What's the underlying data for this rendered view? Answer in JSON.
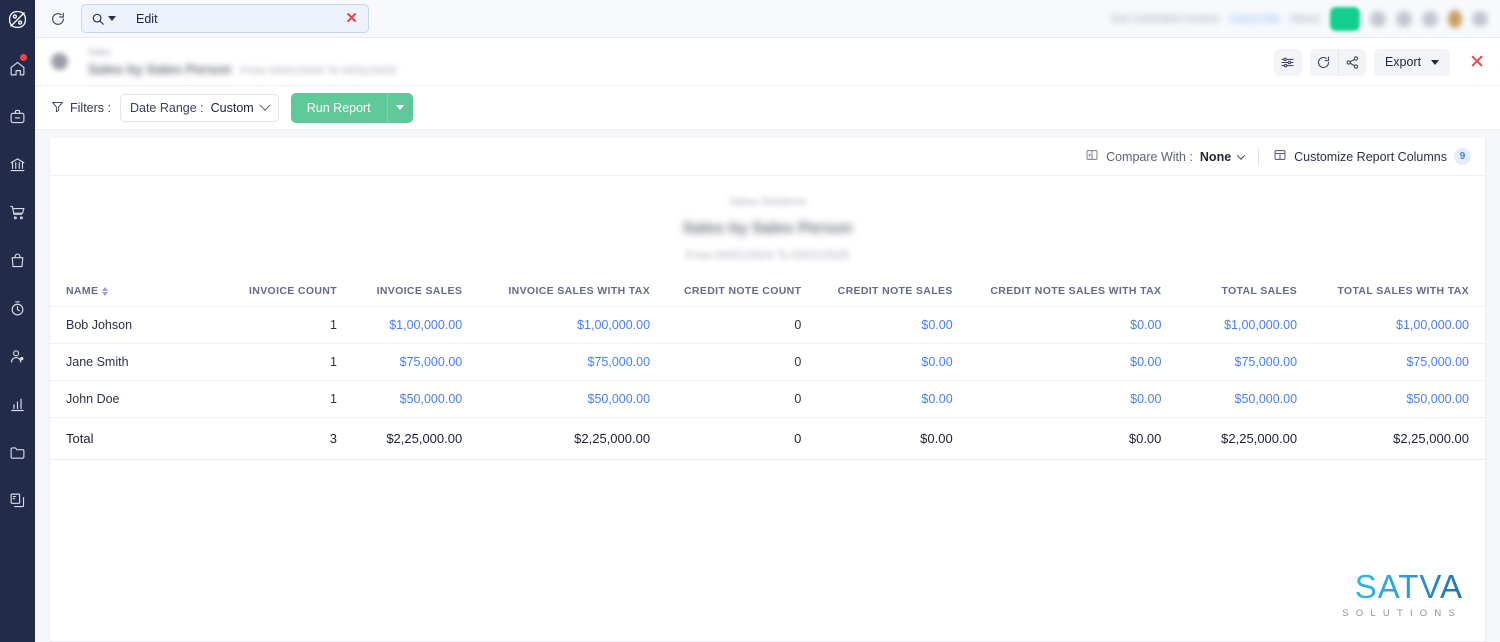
{
  "sidebar": {
    "logo_icon": "brand-b-logo-icon",
    "items": [
      {
        "icon": "home-icon",
        "name": "home",
        "badge": true
      },
      {
        "icon": "briefcase-icon",
        "name": "briefcase",
        "badge": false
      },
      {
        "icon": "bank-icon",
        "name": "banking",
        "badge": false
      },
      {
        "icon": "shopping-cart-icon",
        "name": "sales",
        "badge": false
      },
      {
        "icon": "shopping-bag-icon",
        "name": "purchases",
        "badge": false
      },
      {
        "icon": "stopwatch-icon",
        "name": "time-tracking",
        "badge": false
      },
      {
        "icon": "user-icon",
        "name": "contacts",
        "badge": false
      },
      {
        "icon": "bar-chart-icon",
        "name": "reports",
        "badge": false
      },
      {
        "icon": "folder-icon",
        "name": "documents",
        "badge": false
      },
      {
        "icon": "copy-document-icon",
        "name": "templates",
        "badge": false
      }
    ]
  },
  "topbar": {
    "refresh_icon": "refresh-icon",
    "search": {
      "icon": "search-icon",
      "value": "Edit",
      "clear_icon": "clear-x-icon"
    },
    "right_blurred": {
      "label_1": "Get Unlimited Invoice",
      "label_2": "Subscribe",
      "label_3": "About",
      "chip": "add-new-button",
      "icons": [
        "search-icon",
        "help-icon",
        "bell-icon",
        "avatar-icon",
        "apps-icon"
      ]
    }
  },
  "page_header": {
    "eyebrow": "Sales",
    "title": "Sales by Sales Person",
    "subtitle": "From 04/01/2024 To 03/31/2025",
    "actions": {
      "settings_icon": "sliders-icon",
      "refresh_icon": "refresh-icon",
      "share_icon": "share-icon",
      "export_label": "Export",
      "close_icon": "close-x-icon"
    }
  },
  "filters": {
    "funnel_icon": "funnel-icon",
    "label": "Filters :",
    "date_range_label": "Date Range :",
    "date_range_value": "Custom",
    "run_report_label": "Run Report"
  },
  "report_toolbar": {
    "compare_icon": "compare-panels-icon",
    "compare_label": "Compare With :",
    "compare_value": "None",
    "customize_icon": "columns-layout-icon",
    "customize_label": "Customize Report Columns",
    "customize_badge": "9"
  },
  "report_title": {
    "organization": "Satva Solutions",
    "name": "Sales by Sales Person",
    "range": "From 04/01/2024 To 03/31/2025"
  },
  "table": {
    "columns": [
      "NAME",
      "INVOICE COUNT",
      "INVOICE SALES",
      "INVOICE SALES WITH TAX",
      "CREDIT NOTE COUNT",
      "CREDIT NOTE SALES",
      "CREDIT NOTE SALES WITH TAX",
      "TOTAL SALES",
      "TOTAL SALES WITH TAX"
    ],
    "sort_column": "NAME",
    "rows": [
      {
        "name": "Bob Johson",
        "invoice_count": "1",
        "invoice_sales": "$1,00,000.00",
        "invoice_sales_with_tax": "$1,00,000.00",
        "credit_note_count": "0",
        "credit_note_sales": "$0.00",
        "credit_note_sales_with_tax": "$0.00",
        "total_sales": "$1,00,000.00",
        "total_sales_with_tax": "$1,00,000.00"
      },
      {
        "name": "Jane Smith",
        "invoice_count": "1",
        "invoice_sales": "$75,000.00",
        "invoice_sales_with_tax": "$75,000.00",
        "credit_note_count": "0",
        "credit_note_sales": "$0.00",
        "credit_note_sales_with_tax": "$0.00",
        "total_sales": "$75,000.00",
        "total_sales_with_tax": "$75,000.00"
      },
      {
        "name": "John Doe",
        "invoice_count": "1",
        "invoice_sales": "$50,000.00",
        "invoice_sales_with_tax": "$50,000.00",
        "credit_note_count": "0",
        "credit_note_sales": "$0.00",
        "credit_note_sales_with_tax": "$0.00",
        "total_sales": "$50,000.00",
        "total_sales_with_tax": "$50,000.00"
      }
    ],
    "total_row": {
      "name": "Total",
      "invoice_count": "3",
      "invoice_sales": "$2,25,000.00",
      "invoice_sales_with_tax": "$2,25,000.00",
      "credit_note_count": "0",
      "credit_note_sales": "$0.00",
      "credit_note_sales_with_tax": "$0.00",
      "total_sales": "$2,25,000.00",
      "total_sales_with_tax": "$2,25,000.00"
    }
  },
  "watermark": {
    "word": "SATVA",
    "sub": "SOLUTIONS"
  },
  "colors": {
    "sidebar_bg": "#232b4a",
    "accent_green": "#5fc99b",
    "link_blue": "#4a7ef0",
    "danger_red": "#e8424b",
    "badge_blue": "#4a7fd6"
  }
}
